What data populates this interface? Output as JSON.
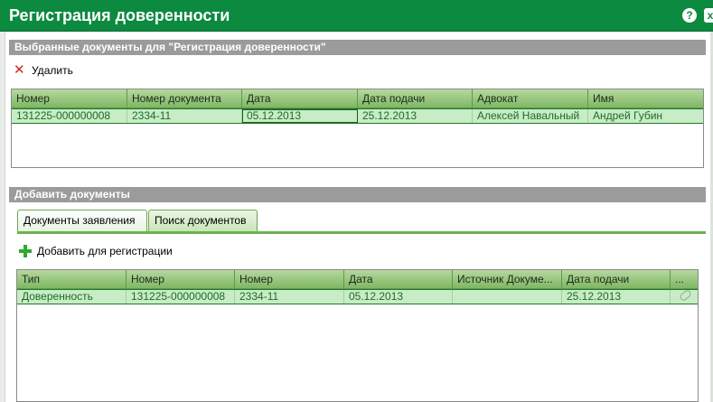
{
  "window": {
    "title": "Регистрация доверенности",
    "help_glyph": "?",
    "close_glyph": "x"
  },
  "selected_section": {
    "title": "Выбранные документы для \"Регистрация доверенности\"",
    "delete_label": "Удалить",
    "columns": [
      "Номер",
      "Номер документа",
      "Дата",
      "Дата подачи",
      "Адвокат",
      "Имя"
    ],
    "rows": [
      [
        "131225-000000008",
        "2334-11",
        "05.12.2013",
        "25.12.2013",
        "Алексей Навальный",
        "Андрей Губин"
      ]
    ]
  },
  "add_section": {
    "title": "Добавить документы",
    "tabs": [
      "Документы заявления",
      "Поиск документов"
    ],
    "active_tab": 0,
    "add_label": "Добавить для регистрации",
    "columns": [
      "Тип",
      "Номер",
      "Номер",
      "Дата",
      "Источник Докуме...",
      "Дата подачи",
      "..."
    ],
    "rows": [
      [
        "Доверенность",
        "131225-000000008",
        "2334-11",
        "05.12.2013",
        "",
        "25.12.2013",
        ""
      ]
    ]
  },
  "icons": {
    "delete": "x-icon",
    "add": "plus-icon",
    "attachment": "paperclip-icon"
  },
  "colors": {
    "title_bar": "#0c8a3f",
    "section_bar": "#9b9b9b",
    "selected_row": "#c8ecc5",
    "row_text": "#1e6b2a"
  }
}
